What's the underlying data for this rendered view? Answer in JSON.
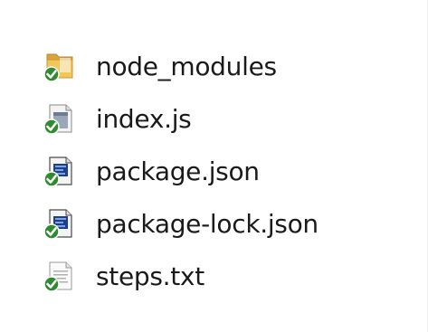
{
  "explorer": {
    "files": [
      {
        "name": "node_modules",
        "icon": "folder-icon",
        "overlay": "synced-check-icon"
      },
      {
        "name": "index.js",
        "icon": "script-file-icon",
        "overlay": "synced-check-icon"
      },
      {
        "name": "package.json",
        "icon": "json-file-icon",
        "overlay": "synced-check-icon"
      },
      {
        "name": "package-lock.json",
        "icon": "json-file-icon",
        "overlay": "synced-check-icon"
      },
      {
        "name": "steps.txt",
        "icon": "text-file-icon",
        "overlay": "synced-check-icon"
      }
    ]
  },
  "colors": {
    "folder": "#e8b84a",
    "check": "#2e8b2e",
    "text": "#1a1a1a",
    "background": "#ffffff"
  }
}
